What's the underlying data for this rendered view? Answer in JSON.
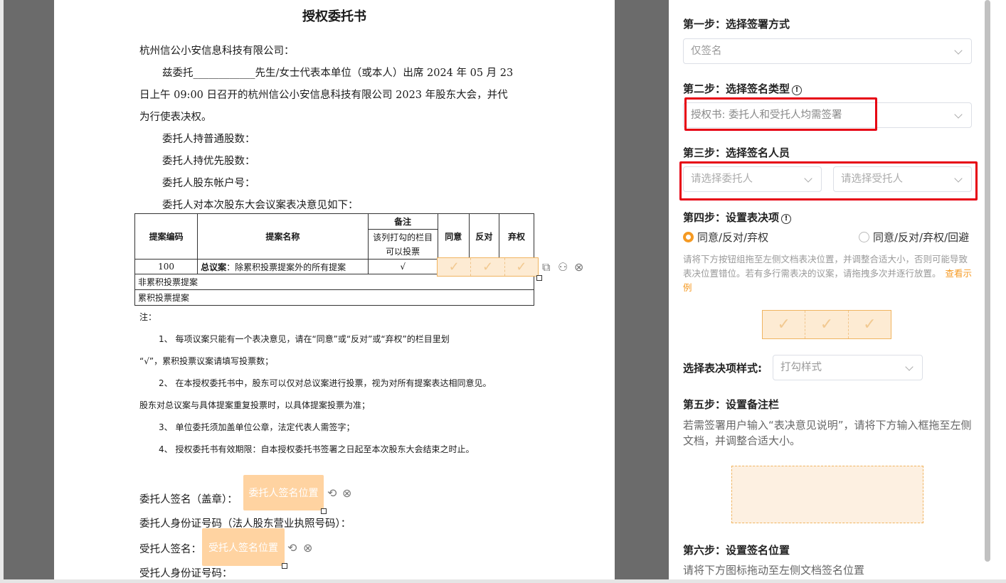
{
  "document": {
    "title": "授权委托书",
    "addressee": "杭州信公小安信息科技有限公司：",
    "para1_line1": "兹委托____________先生/女士代表本单位（或本人）出席 2024 年 05 月 23",
    "para1_line2": "日上午 09:00 日召开的杭州信公小安信息科技有限公司 2023 年股东大会，并代",
    "para1_line3": "为行使表决权。",
    "common_shares": "委托人持普通股数：",
    "preferred_shares": "委托人持优先股数：",
    "account": "委托人股东帐户号：",
    "opinion_intro": "委托人对本次股东大会议案表决意见如下：",
    "table": {
      "h_code": "提案编码",
      "h_name": "提案名称",
      "h_remark": "备注",
      "h_remark_sub": "该列打勾的栏目可以投票",
      "h_agree": "同意",
      "h_against": "反对",
      "h_abstain": "弃权",
      "row_code": "100",
      "row_name_bold": "总议案",
      "row_name_rest": "：除累积投票提案外的所有提案",
      "row_check": "√",
      "non_cumulative": "非累积投票提案",
      "cumulative": "累积投票提案"
    },
    "note_label": "注：",
    "note1_a": "1、   每项议案只能有一个表决意见，请在“同意”或“反对”或“弃权”的栏目里划",
    "note1_b": "“√”，累积投票议案请填写投票数；",
    "note2_a": "2、   在本授权委托书中，股东可以仅对总议案进行投票，视为对所有提案表达相同意见。",
    "note2_b": "股东对总议案与具体提案重复投票时，以具体提案投票为准；",
    "note3": "3、   单位委托须加盖单位公章，法定代表人需签字；",
    "note4": "4、   授权委托书有效期限：自本授权委托书签署之日起至本次股东大会结束之时止。",
    "principal_sign": "委托人签名（盖章）：",
    "principal_id": "委托人身份证号码（法人股东营业执照号码）：",
    "agent_sign": "受托人签名：",
    "agent_id": "受托人身份证号码：",
    "principal_sign_box": "委托人签名位置",
    "agent_sign_box": "受托人签名位置",
    "vote_mark": "✓"
  },
  "panel": {
    "step1_title": "第一步：选择签署方式",
    "step1_value": "仅签名",
    "step2_title": "第二步：选择签名类型",
    "step2_value": "授权书: 委托人和受托人均需签署",
    "step3_title": "第三步：选择签名人员",
    "step3_principal_placeholder": "请选择委托人",
    "step3_agent_placeholder": "请选择受托人",
    "step4_title": "第四步：设置表决项",
    "radio_option1": "同意/反对/弃权",
    "radio_option2": "同意/反对/弃权/回避",
    "radio_selected": "同意/反对/弃权",
    "step4_hint": "请将下方按钮组拖至左侧文档表决位置，并调整合适大小，否则可能导致表决位置错位。若有多行需表决的议案，请拖拽多次并逐行放置。",
    "step4_hint_link": "查看示例",
    "style_label": "选择表决项样式:",
    "style_value": "打勾样式",
    "step5_title": "第五步：设置备注栏",
    "step5_desc": "若需签署用户输入“表决意见说明”，请将下方输入框拖至左侧文档，并调整合适大小。",
    "step6_title": "第六步：设置签名位置",
    "step6_desc": "请将下方图标拖动至左侧文档签名位置",
    "info_glyph": "!",
    "highlight_color": "#e60012",
    "accent_color": "#f59a23"
  }
}
